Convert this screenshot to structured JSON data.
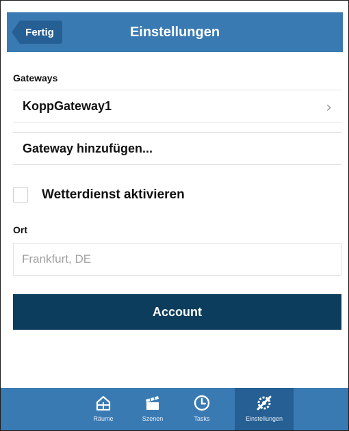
{
  "navbar": {
    "back_label": "Fertig",
    "title": "Einstellungen"
  },
  "gateways": {
    "section_label": "Gateways",
    "items": [
      {
        "label": "KoppGateway1"
      },
      {
        "label": "Gateway hinzufügen..."
      }
    ]
  },
  "weather": {
    "checkbox_label": "Wetterdienst aktivieren",
    "checked": false
  },
  "location": {
    "section_label": "Ort",
    "placeholder": "Frankfurt, DE"
  },
  "account_button": "Account",
  "tabbar": {
    "tabs": [
      {
        "label": "Räume",
        "icon": "rooms-icon"
      },
      {
        "label": "Szenen",
        "icon": "scenes-icon"
      },
      {
        "label": "Tasks",
        "icon": "clock-icon"
      },
      {
        "label": "Einstellungen",
        "icon": "settings-icon",
        "active": true
      }
    ]
  },
  "colors": {
    "navbar": "#3a7ab3",
    "back_button": "#255f93",
    "account_button": "#0d3d5c",
    "tabbar": "#3a7ab3",
    "tab_active": "#255f93"
  }
}
